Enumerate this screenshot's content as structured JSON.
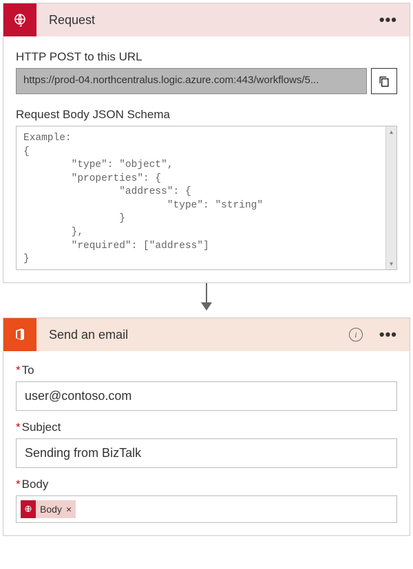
{
  "request_card": {
    "title": "Request",
    "url_label": "HTTP POST to this URL",
    "url_value": "https://prod-04.northcentralus.logic.azure.com:443/workflows/5...",
    "schema_label": "Request Body JSON Schema",
    "schema_text": "Example:\n{\n        \"type\": \"object\",\n        \"properties\": {\n                \"address\": {\n                        \"type\": \"string\"\n                }\n        },\n        \"required\": [\"address\"]\n}"
  },
  "email_card": {
    "title": "Send an email",
    "labels": {
      "to": "To",
      "subject": "Subject",
      "body": "Body"
    },
    "values": {
      "to": "user@contoso.com",
      "subject": "Sending from BizTalk"
    },
    "body_token": {
      "label": "Body",
      "close": "×"
    }
  },
  "glyphs": {
    "asterisk": "*",
    "info": "i",
    "ellipsis": "•••",
    "arrow_up": "▴",
    "arrow_down": "▾"
  }
}
